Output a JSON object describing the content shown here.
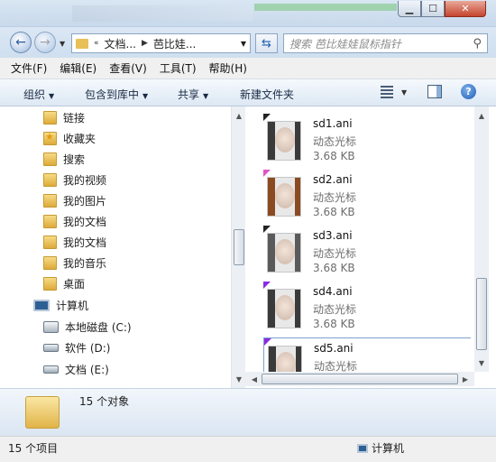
{
  "window": {
    "minimize_glyph": "▁",
    "maximize_glyph": "☐",
    "close_glyph": "✕"
  },
  "navigation": {
    "address": {
      "overflow_glyph": "«",
      "crumbs": [
        "文档...",
        "芭比娃..."
      ]
    },
    "search_placeholder": "搜索 芭比娃娃鼠标指针"
  },
  "menu": [
    "文件(F)",
    "编辑(E)",
    "查看(V)",
    "工具(T)",
    "帮助(H)"
  ],
  "commands": {
    "organize": "组织",
    "include_in_library": "包含到库中",
    "share": "共享",
    "new_folder": "新建文件夹"
  },
  "nav_tree": [
    {
      "label": "链接",
      "icon": "links-folder-icon"
    },
    {
      "label": "收藏夹",
      "icon": "favorites-icon"
    },
    {
      "label": "搜索",
      "icon": "search-folder-icon"
    },
    {
      "label": "我的视频",
      "icon": "videos-folder-icon"
    },
    {
      "label": "我的图片",
      "icon": "pictures-folder-icon"
    },
    {
      "label": "我的文档",
      "icon": "documents-folder-icon"
    },
    {
      "label": "我的文档",
      "icon": "documents-folder-icon"
    },
    {
      "label": "我的音乐",
      "icon": "music-folder-icon"
    },
    {
      "label": "桌面",
      "icon": "desktop-folder-icon"
    },
    {
      "label": "计算机",
      "icon": "computer-icon"
    },
    {
      "label": "本地磁盘 (C:)",
      "icon": "system-drive-icon"
    },
    {
      "label": "软件 (D:)",
      "icon": "drive-icon"
    },
    {
      "label": "文档 (E:)",
      "icon": "drive-icon"
    }
  ],
  "files": [
    {
      "name": "sd1.ani",
      "type": "动态光标",
      "size": "3.68 KB",
      "cursor_color": "#222222"
    },
    {
      "name": "sd2.ani",
      "type": "动态光标",
      "size": "3.68 KB",
      "cursor_color": "#e055c4"
    },
    {
      "name": "sd3.ani",
      "type": "动态光标",
      "size": "3.68 KB",
      "cursor_color": "#222222"
    },
    {
      "name": "sd4.ani",
      "type": "动态光标",
      "size": "3.68 KB",
      "cursor_color": "#8a2be2"
    },
    {
      "name": "sd5.ani",
      "type": "动态光标",
      "size": "",
      "cursor_color": "#8a2be2"
    }
  ],
  "details": {
    "count": "15 个对象"
  },
  "status": {
    "items": "15 个项目",
    "location": "计算机"
  },
  "colors": {
    "accent": "#1d5fae",
    "selection_border": "#7da2ce"
  }
}
